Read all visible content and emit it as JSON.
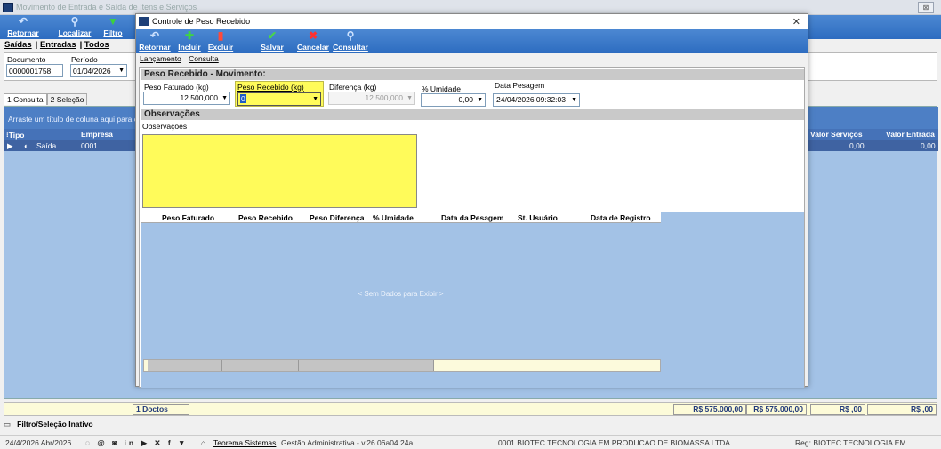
{
  "bg_window": {
    "title": "Movimento de Entrada e Saída de Itens e Serviços",
    "toolbar": [
      {
        "label": "Retornar",
        "icon": "undo-icon",
        "glyph": "↶",
        "color": "#cfe3ff"
      },
      {
        "label": "Localizar",
        "icon": "search-icon",
        "glyph": "⚲",
        "color": "#cfe3ff"
      },
      {
        "label": "Filtro",
        "icon": "filter-icon",
        "glyph": "▼",
        "color": "#3bd13b"
      }
    ],
    "tabs": [
      "Saídas",
      "Entradas",
      "Todos"
    ],
    "documento_label": "Documento",
    "documento_value": "0000001758",
    "periodo_label": "Período",
    "periodo_value": "01/04/2026",
    "subtabs": [
      "1 Consulta",
      "2 Seleção"
    ],
    "group_hint": "Arraste um título de coluna aqui para criar u",
    "columns": {
      "tipo": "Tipo",
      "empresa": "Empresa",
      "valor_servicos": "Valor Serviços",
      "valor_entrada": "Valor Entrada"
    },
    "row": {
      "tipo": "Saída",
      "empresa": "0001",
      "valor_servicos": "0,00",
      "valor_entrada": "0,00"
    },
    "footer": {
      "doctos": "1 Doctos",
      "total1": "R$ 575.000,00",
      "total2": "R$ 575.000,00",
      "total3": "R$ ,00",
      "total4": "R$ ,00"
    },
    "filter_status": "Filtro/Seleção Inativo"
  },
  "dialog": {
    "title": "Controle de Peso Recebido",
    "toolbar": [
      {
        "label": "Retornar",
        "icon": "undo-icon",
        "glyph": "↶",
        "color": "#cfe3ff"
      },
      {
        "label": "Incluir",
        "icon": "plus-icon",
        "glyph": "✚",
        "color": "#3ed63e"
      },
      {
        "label": "Excluir",
        "icon": "delete-icon",
        "glyph": "▮",
        "color": "#ff4a3a"
      },
      {
        "label": "Salvar",
        "icon": "check-icon",
        "glyph": "✔",
        "color": "#49d649"
      },
      {
        "label": "Cancelar",
        "icon": "cancel-icon",
        "glyph": "✖",
        "color": "#ff3030"
      },
      {
        "label": "Consultar",
        "icon": "search-icon",
        "glyph": "⚲",
        "color": "#cfe3ff"
      }
    ],
    "tabs": [
      "Lançamento",
      "Consulta"
    ],
    "section_movimento": "Peso Recebido - Movimento:",
    "peso_faturado_label": "Peso Faturado (kg)",
    "peso_faturado_value": "12.500,000",
    "peso_recebido_label": "Peso Recebido (kg)",
    "peso_recebido_value": "0",
    "diferenca_label": "Diferença (kg)",
    "diferenca_value": "12.500,000",
    "umidade_label": "% Umidade",
    "umidade_value": "0,00",
    "data_pesagem_label": "Data Pesagem",
    "data_pesagem_value": "24/04/2026 09:32:03",
    "section_obs": "Observações",
    "obs_label": "Observações",
    "grid_columns": [
      "Peso Faturado",
      "Peso Recebido",
      "Peso Diferença",
      "% Umidade",
      "Data da Pesagem",
      "St. Usuário",
      "Data de Registro"
    ],
    "grid_empty": "< Sem Dados para Exibir >"
  },
  "statusbar": {
    "date": "24/4/2026 Abr/2026",
    "company_link": "Teorema Sistemas",
    "app": "Gestão Administrativa - v.26.06a04.24a",
    "empresa": "0001 BIOTEC TECNOLOGIA EM PRODUCAO DE BIOMASSA LTDA",
    "reg": "Reg: BIOTEC TECNOLOGIA EM PRODUCAO"
  }
}
